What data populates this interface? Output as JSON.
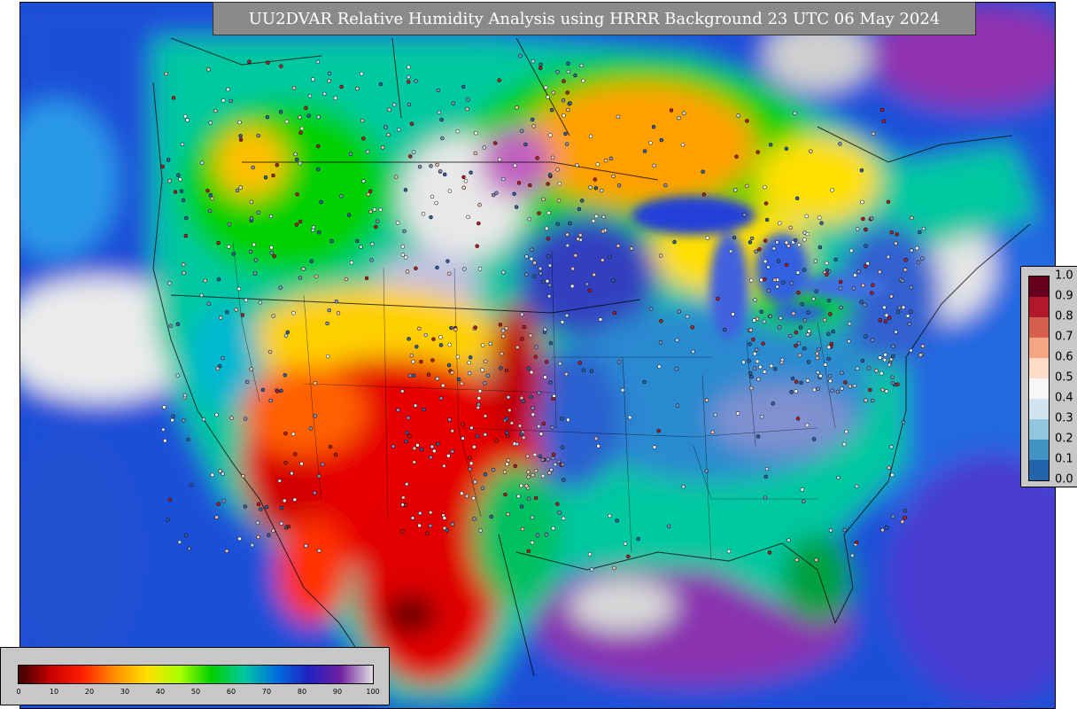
{
  "title": "UU2DVAR Relative Humidity Analysis using HRRR Background 23 UTC 06 May 2024",
  "colorbar_rh": {
    "ticks": [
      "0",
      "10",
      "20",
      "30",
      "40",
      "50",
      "60",
      "70",
      "80",
      "90",
      "100"
    ],
    "colors": [
      "#3a0000",
      "#c80000",
      "#ff2000",
      "#ff9000",
      "#ffe000",
      "#aaff00",
      "#00d000",
      "#00c8a0",
      "#0070e0",
      "#2020c0",
      "#7020a0",
      "#e0e0e0"
    ]
  },
  "colorbar_obs": {
    "ticks": [
      "1.0",
      "0.9",
      "0.8",
      "0.7",
      "0.6",
      "0.5",
      "0.4",
      "0.3",
      "0.2",
      "0.1",
      "0.0"
    ],
    "colors": [
      "#67001f",
      "#b2182b",
      "#d6604d",
      "#f4a582",
      "#fddbc7",
      "#f7f7f7",
      "#d1e5f0",
      "#92c5de",
      "#4393c3",
      "#2166ac",
      "#053061"
    ]
  }
}
